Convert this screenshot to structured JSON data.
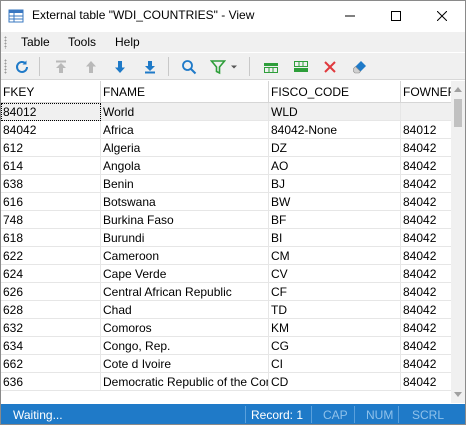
{
  "window": {
    "title": "External table \"WDI_COUNTRIES\" - View"
  },
  "menu": [
    "Table",
    "Tools",
    "Help"
  ],
  "toolbar": {
    "buttons": [
      "refresh-icon",
      "move-first-icon",
      "move-up-icon",
      "move-down-icon",
      "move-last-icon",
      "search-icon",
      "filter-icon",
      "filter-dropdown-icon",
      "insert-row-icon",
      "add-row-icon",
      "delete-icon",
      "clear-icon"
    ]
  },
  "grid": {
    "columns": [
      "FKEY",
      "FNAME",
      "FISCO_CODE",
      "FOWNER"
    ],
    "rows": [
      [
        "84012",
        "World",
        "WLD",
        ""
      ],
      [
        "84042",
        "Africa",
        "84042-None",
        "84012"
      ],
      [
        "612",
        "Algeria",
        "DZ",
        "84042"
      ],
      [
        "614",
        "Angola",
        "AO",
        "84042"
      ],
      [
        "638",
        "Benin",
        "BJ",
        "84042"
      ],
      [
        "616",
        "Botswana",
        "BW",
        "84042"
      ],
      [
        "748",
        "Burkina Faso",
        "BF",
        "84042"
      ],
      [
        "618",
        "Burundi",
        "BI",
        "84042"
      ],
      [
        "622",
        "Cameroon",
        "CM",
        "84042"
      ],
      [
        "624",
        "Cape Verde",
        "CV",
        "84042"
      ],
      [
        "626",
        "Central African Republic",
        "CF",
        "84042"
      ],
      [
        "628",
        "Chad",
        "TD",
        "84042"
      ],
      [
        "632",
        "Comoros",
        "KM",
        "84042"
      ],
      [
        "634",
        "Congo, Rep.",
        "CG",
        "84042"
      ],
      [
        "662",
        "Cote d Ivoire",
        "CI",
        "84042"
      ],
      [
        "636",
        "Democratic Republic of the Congo",
        "CD",
        "84042"
      ]
    ]
  },
  "status": {
    "state": "Waiting...",
    "record": "Record: 1",
    "cap": "CAP",
    "num": "NUM",
    "scrl": "SCRL"
  },
  "colors": {
    "status_bar": "#1f7ac8",
    "accent_blue": "#1f7ac8",
    "green": "#2e9e3a",
    "red": "#e0393e"
  }
}
